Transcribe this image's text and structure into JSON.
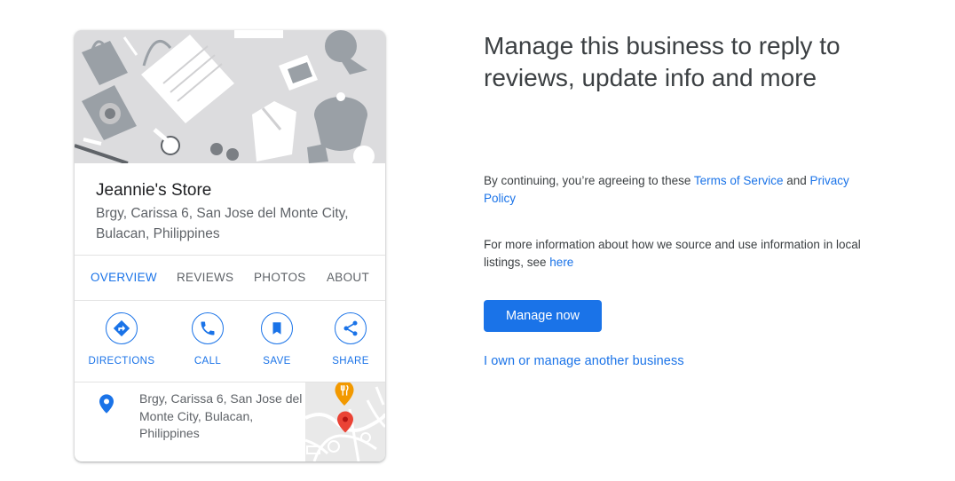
{
  "card": {
    "store_name": "Jeannie's Store",
    "address": "Brgy, Carissa 6, San Jose del Monte City, Bulacan, Philippines",
    "tabs": [
      {
        "label": "OVERVIEW",
        "active": true
      },
      {
        "label": "REVIEWS",
        "active": false
      },
      {
        "label": "PHOTOS",
        "active": false
      },
      {
        "label": "ABOUT",
        "active": false
      }
    ],
    "actions": [
      {
        "label": "DIRECTIONS",
        "icon": "directions-icon"
      },
      {
        "label": "CALL",
        "icon": "phone-icon"
      },
      {
        "label": "SAVE",
        "icon": "bookmark-icon"
      },
      {
        "label": "SHARE",
        "icon": "share-icon"
      }
    ],
    "location_address": "Brgy, Carissa 6, San Jose del Monte City, Bulacan, Philippines",
    "location_icon": "location-pin-icon",
    "map_markers": [
      "restaurant-marker-icon",
      "red-location-marker-icon"
    ]
  },
  "panel": {
    "headline": "Manage this business to reply to reviews, update info and more",
    "terms_prefix": "By continuing, you’re agreeing to these ",
    "terms_link": "Terms of Service",
    "terms_and": " and ",
    "privacy_link": "Privacy Policy",
    "info_prefix": "For more information about how we source and use information in local listings, see ",
    "info_link": "here",
    "manage_button": "Manage now",
    "own_link": "I own or manage another business"
  },
  "colors": {
    "accent": "#1a73e8",
    "text_secondary": "#5f6368",
    "map_pin_red": "#ea4335",
    "restaurant_marker": "#f29900"
  }
}
